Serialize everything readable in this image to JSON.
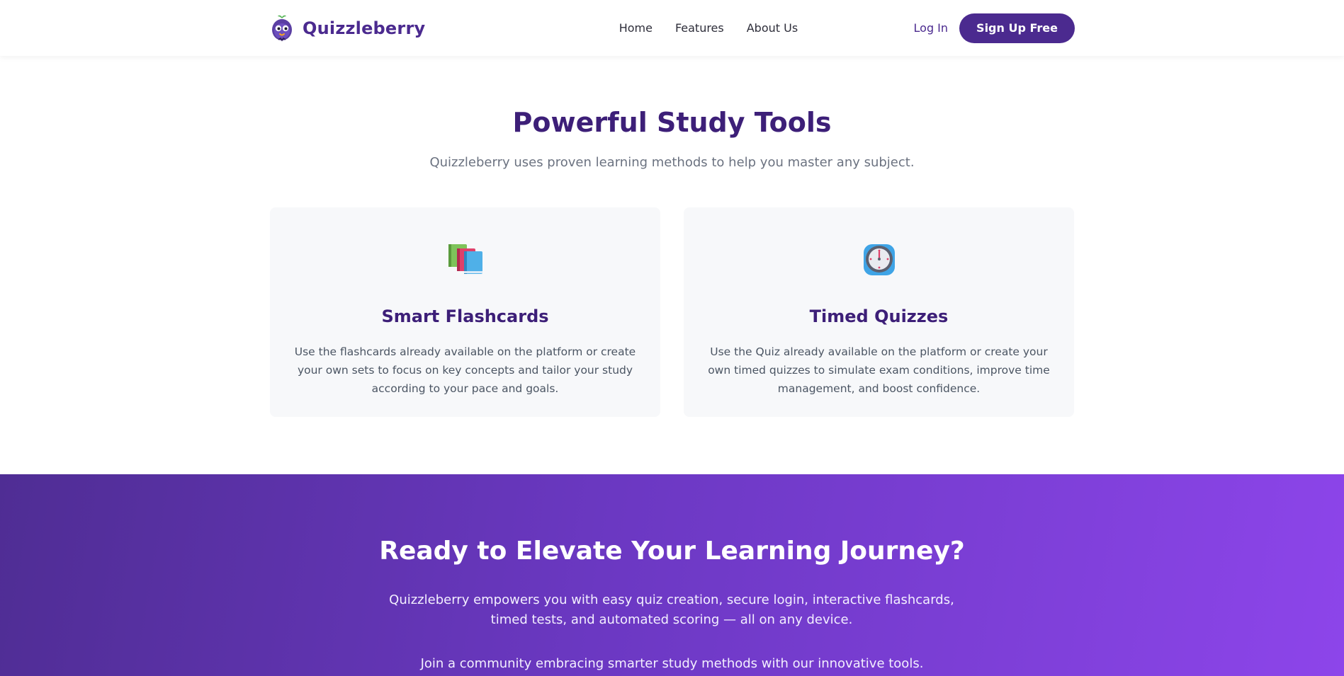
{
  "brand": {
    "name": "Quizzleberry",
    "logo_icon": "blueberry-mascot-icon"
  },
  "nav": {
    "links": [
      "Home",
      "Features",
      "About Us"
    ],
    "login_label": "Log In",
    "signup_label": "Sign Up Free"
  },
  "features": {
    "title": "Powerful Study Tools",
    "subtitle": "Quizzleberry uses proven learning methods to help you master any subject.",
    "cards": [
      {
        "icon": "books-icon",
        "title": "Smart Flashcards",
        "text": "Use the flashcards already available on the platform or create your own sets to focus on key concepts and tailor your study according to your pace and goals."
      },
      {
        "icon": "stopwatch-icon",
        "title": "Timed Quizzes",
        "text": "Use the Quiz already available on the platform or create your own timed quizzes to simulate exam conditions, improve time management, and boost confidence."
      }
    ]
  },
  "cta": {
    "title": "Ready to Elevate Your Learning Journey?",
    "text": "Quizzleberry empowers you with easy quiz creation, secure login, interactive flashcards, timed tests, and automated scoring — all on any device.",
    "text2": "Join a community embracing smarter study methods with our innovative tools."
  },
  "colors": {
    "brand_primary": "#4b2a8f",
    "heading": "#3d1f78",
    "card_bg": "#f7f8fa",
    "cta_gradient_start": "#4f2d94",
    "cta_gradient_end": "#8d45ea"
  }
}
